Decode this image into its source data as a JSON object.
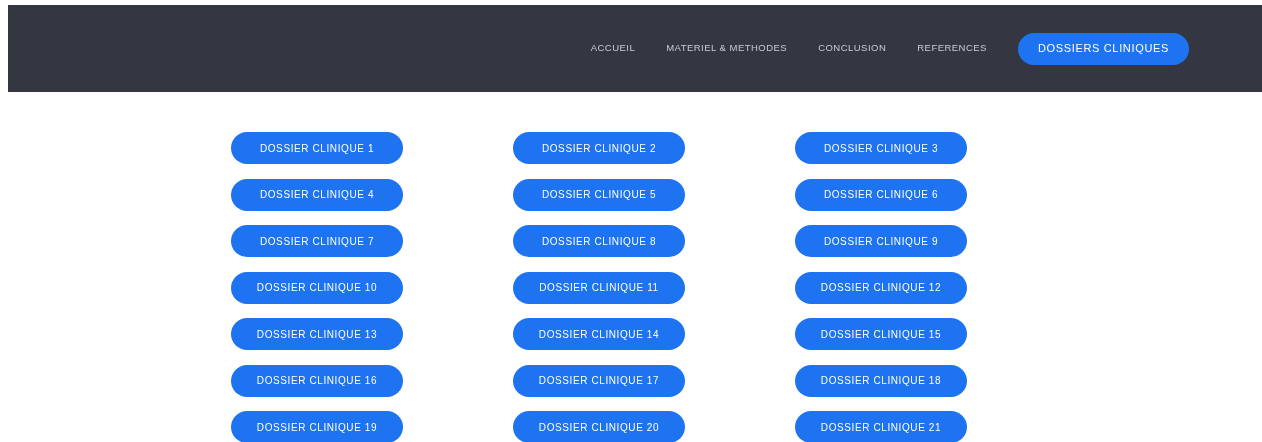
{
  "nav": [
    {
      "label": "ACCUEIL",
      "selected": false
    },
    {
      "label": "MATERIEL & METHODES",
      "selected": false
    },
    {
      "label": "CONCLUSION",
      "selected": false
    },
    {
      "label": "REFERENCES",
      "selected": false
    },
    {
      "label": "DOSSIERS CLINIQUES",
      "selected": true
    }
  ],
  "dossiers": [
    "DOSSIER CLINIQUE 1",
    "DOSSIER CLINIQUE 2",
    "DOSSIER CLINIQUE 3",
    "DOSSIER CLINIQUE 4",
    "DOSSIER CLINIQUE 5",
    "DOSSIER CLINIQUE 6",
    "DOSSIER CLINIQUE 7",
    "DOSSIER CLINIQUE 8",
    "DOSSIER CLINIQUE 9",
    "DOSSIER CLINIQUE 10",
    "DOSSIER CLINIQUE 11",
    "DOSSIER CLINIQUE 12",
    "DOSSIER CLINIQUE 13",
    "DOSSIER CLINIQUE 14",
    "DOSSIER CLINIQUE 15",
    "DOSSIER CLINIQUE 16",
    "DOSSIER CLINIQUE 17",
    "DOSSIER CLINIQUE 18",
    "DOSSIER CLINIQUE 19",
    "DOSSIER CLINIQUE 20",
    "DOSSIER CLINIQUE 21"
  ]
}
